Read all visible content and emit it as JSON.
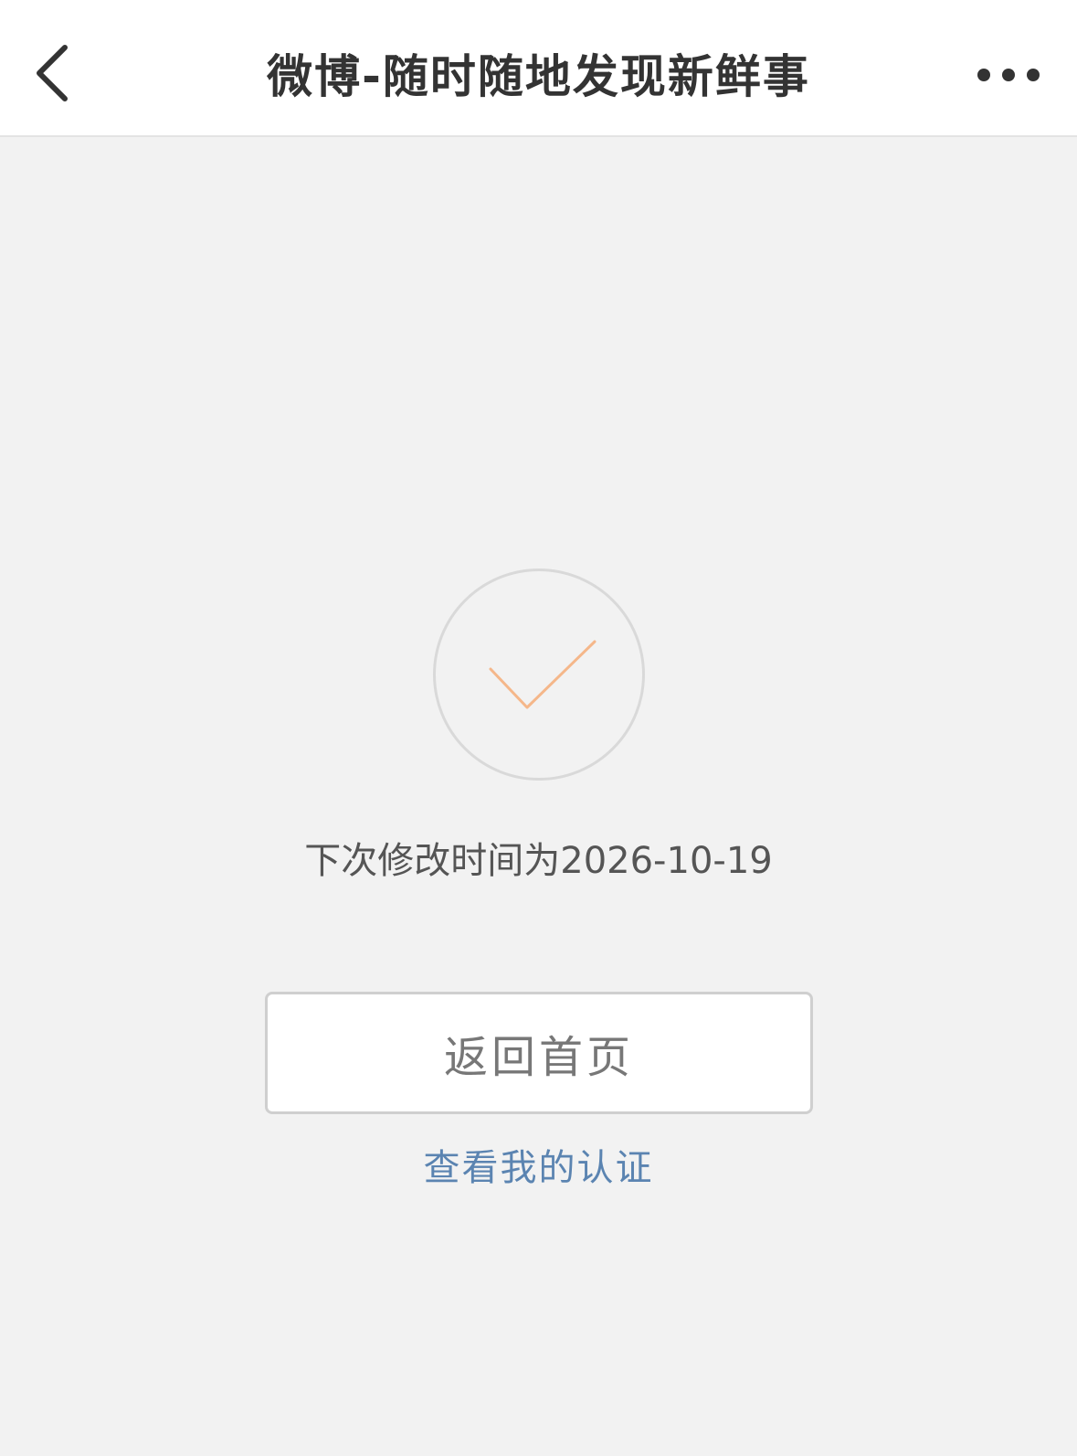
{
  "nav": {
    "title": "微博-随时随地发现新鲜事",
    "back_icon": "chevron-left-icon",
    "more_icon": "more-horizontal-icon"
  },
  "status": {
    "icon": "check-icon",
    "message": "下次修改时间为2026-10-19"
  },
  "actions": {
    "home_label": "返回首页",
    "cert_link_label": "查看我的认证"
  },
  "colors": {
    "check": "#f5b78a",
    "link": "#5b84b1",
    "background": "#f2f2f2"
  }
}
